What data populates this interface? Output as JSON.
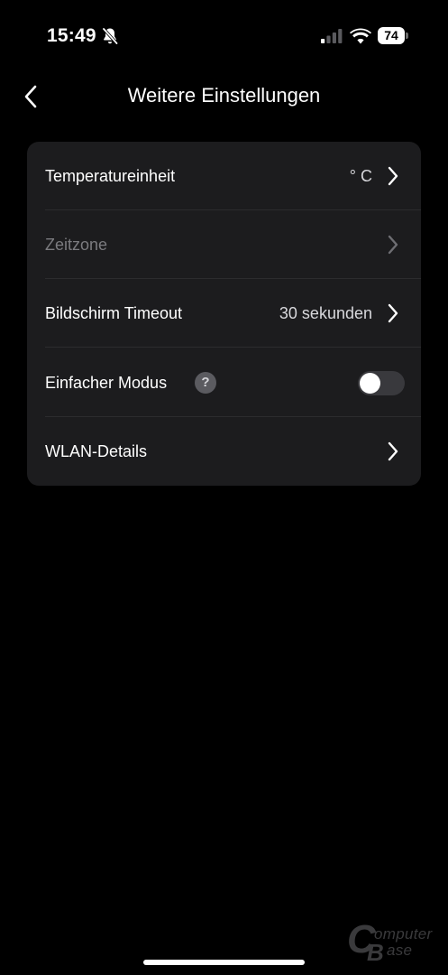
{
  "status_bar": {
    "time": "15:49",
    "battery_level": "74",
    "icons": [
      "bell-slash-icon",
      "cellular-signal-icon",
      "wifi-icon",
      "battery-icon"
    ]
  },
  "nav": {
    "title": "Weitere Einstellungen",
    "back_icon": "chevron-left-icon"
  },
  "settings": {
    "rows": [
      {
        "label": "Temperatureinheit",
        "value": "° C",
        "enabled": true,
        "control": "chevron"
      },
      {
        "label": "Zeitzone",
        "value": "",
        "enabled": false,
        "control": "chevron"
      },
      {
        "label": "Bildschirm Timeout",
        "value": "30 sekunden",
        "enabled": true,
        "control": "chevron"
      },
      {
        "label": "Einfacher Modus",
        "value": "",
        "enabled": true,
        "control": "toggle",
        "toggle_on": false,
        "help_icon": "?"
      },
      {
        "label": "WLAN-Details",
        "value": "",
        "enabled": true,
        "control": "chevron"
      }
    ]
  },
  "watermark": {
    "letter_c": "C",
    "letter_b": "B",
    "line1": "omputer",
    "line2": "ase"
  },
  "colors": {
    "background": "#000000",
    "card": "#1c1c1e",
    "divider": "#2c2c2e",
    "text_primary": "#ffffff",
    "text_disabled": "#7b7b7f",
    "toggle_off": "#39393d",
    "help_badge": "#5b5b60"
  }
}
